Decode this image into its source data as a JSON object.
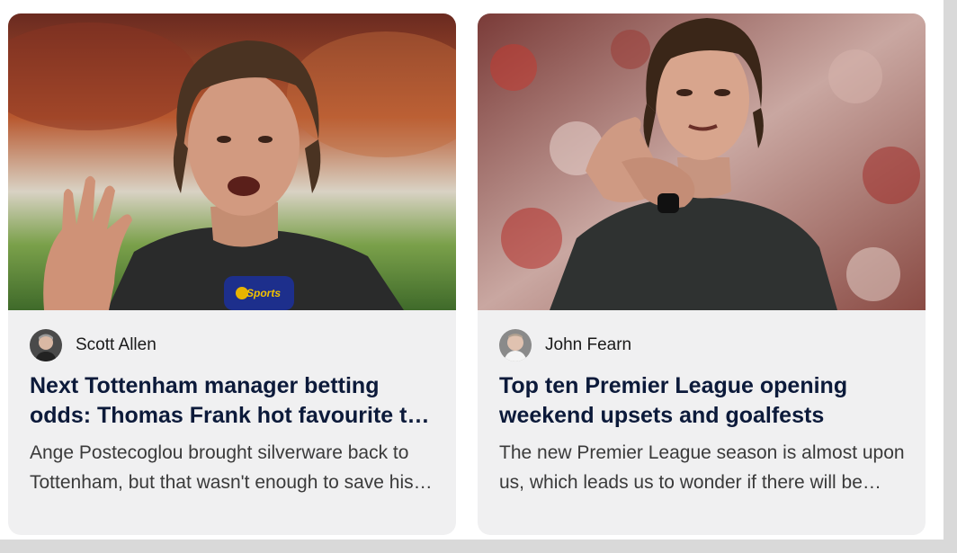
{
  "cards": [
    {
      "author": "Scott Allen",
      "title": "Next Tottenham manager betting odds: Thomas Frank hot favourite to replace Postecoglou",
      "excerpt": "Ange Postecoglou brought silverware back to Tottenham, but that wasn't enough to save his job",
      "image": "photo-thomas-frank-interview",
      "mic_flag_text": "Sports"
    },
    {
      "author": "John Fearn",
      "title": "Top ten Premier League opening weekend upsets and goalfests",
      "excerpt": "The new Premier League season is almost upon us, which leads us to wonder if there will be surprises",
      "image": "photo-thomas-frank-applauding"
    }
  ],
  "colors": {
    "page_background": "#d9d9d9",
    "panel": "#ffffff",
    "card": "#f0f0f1",
    "title": "#0c1a3a",
    "excerpt": "#3a3a3a",
    "mic_flag": "#1d2f8c"
  }
}
